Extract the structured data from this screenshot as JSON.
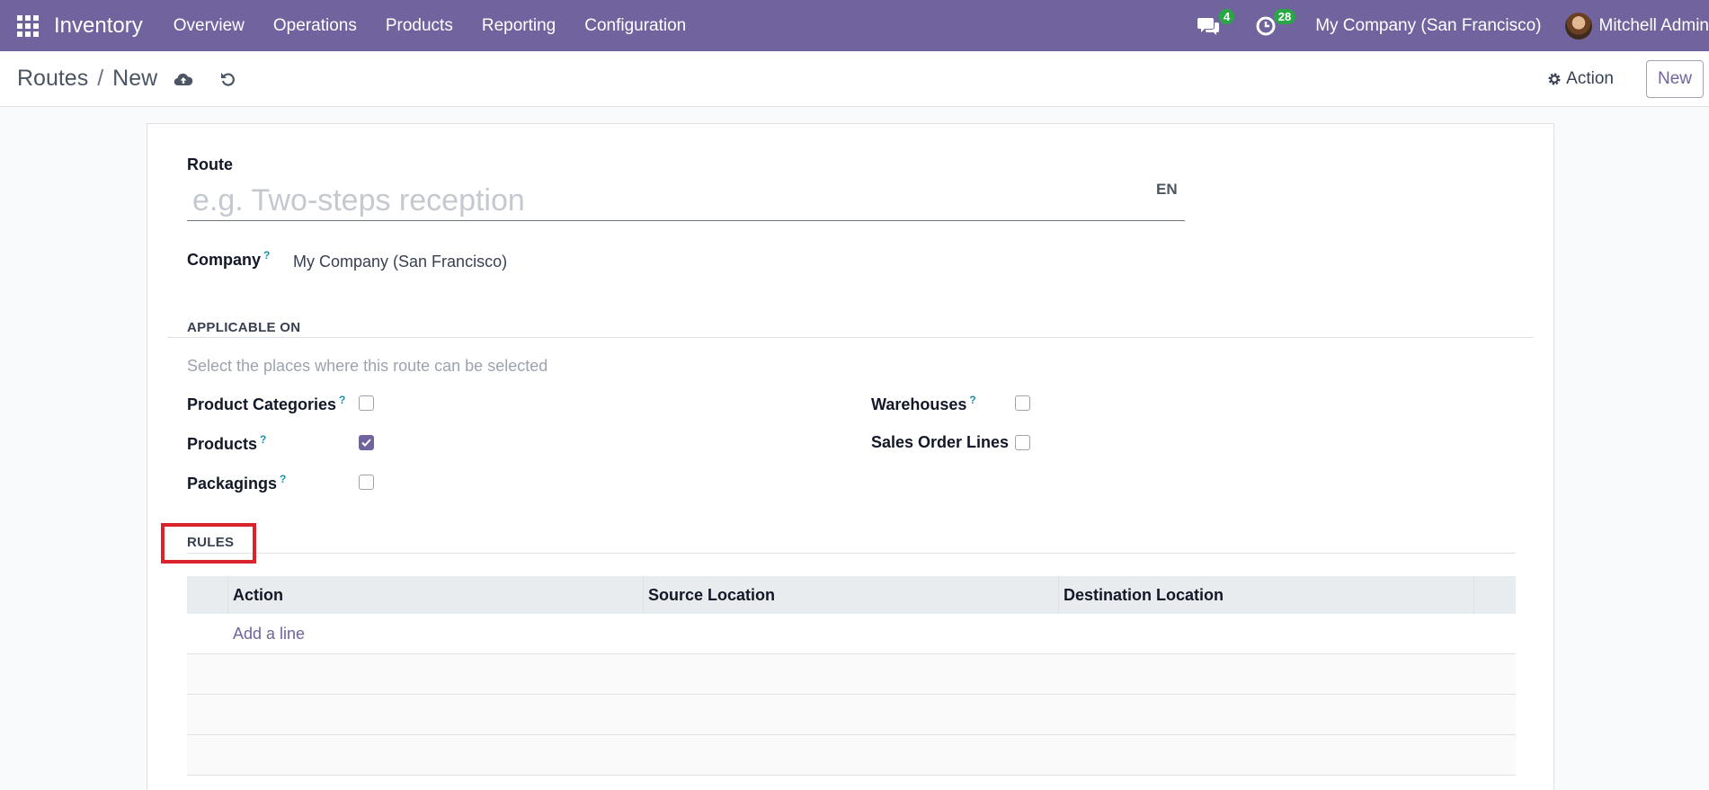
{
  "navbar": {
    "app_name": "Inventory",
    "menu": [
      "Overview",
      "Operations",
      "Products",
      "Reporting",
      "Configuration"
    ],
    "messages_count": "4",
    "activities_count": "28",
    "company": "My Company (San Francisco)",
    "user": "Mitchell Admin",
    "accent_color": "#71639e"
  },
  "control_panel": {
    "breadcrumb_parent": "Routes",
    "breadcrumb_sep": "/",
    "breadcrumb_current": "New",
    "action_label": "Action",
    "new_label": "New"
  },
  "form": {
    "route_label": "Route",
    "route_placeholder": "e.g. Two-steps reception",
    "lang": "EN",
    "company_label": "Company",
    "company_value": "My Company (San Francisco)",
    "help_mark": "?"
  },
  "applicable_on": {
    "title": "APPLICABLE ON",
    "hint": "Select the places where this route can be selected",
    "left": [
      {
        "label": "Product Categories",
        "help": true,
        "checked": false
      },
      {
        "label": "Products",
        "help": true,
        "checked": true
      },
      {
        "label": "Packagings",
        "help": true,
        "checked": false
      }
    ],
    "right": [
      {
        "label": "Warehouses",
        "help": true,
        "checked": false
      },
      {
        "label": "Sales Order Lines",
        "help": false,
        "checked": false
      }
    ]
  },
  "rules": {
    "title": "RULES",
    "columns": [
      "Action",
      "Source Location",
      "Destination Location"
    ],
    "add_line": "Add a line"
  }
}
